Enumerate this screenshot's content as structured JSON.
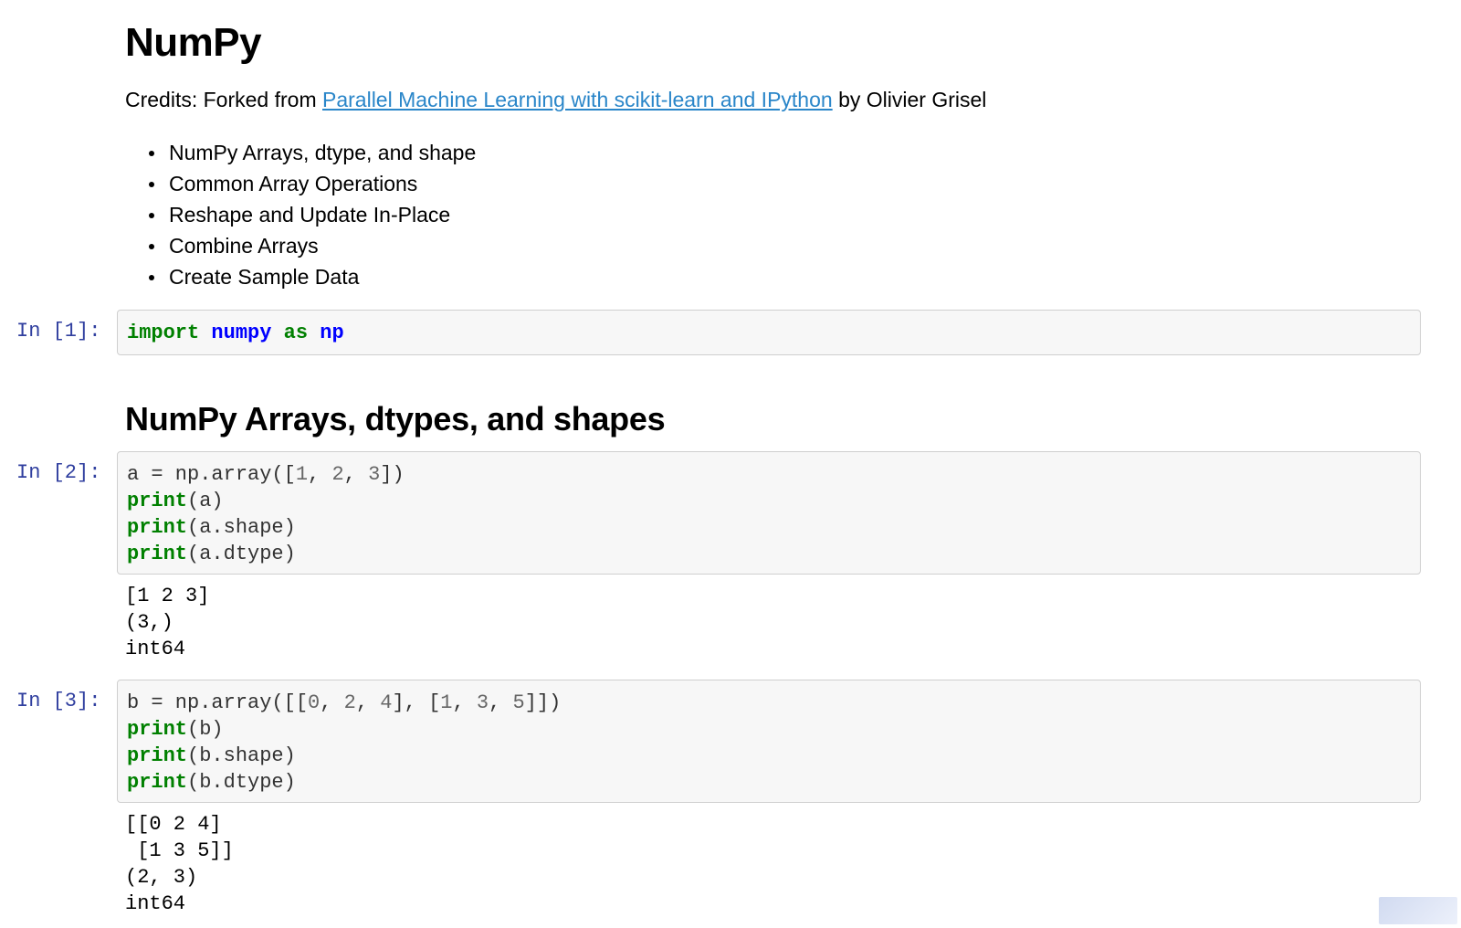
{
  "title": "NumPy",
  "credits": {
    "prefix": "Credits: Forked from ",
    "link_text": "Parallel Machine Learning with scikit-learn and IPython",
    "suffix": " by Olivier Grisel"
  },
  "toc": [
    "NumPy Arrays, dtype, and shape",
    "Common Array Operations",
    "Reshape and Update In-Place",
    "Combine Arrays",
    "Create Sample Data"
  ],
  "section_heading": "NumPy Arrays, dtypes, and shapes",
  "cells": [
    {
      "prompt": "In [1]:",
      "tokens": [
        [
          [
            "kw",
            "import"
          ],
          [
            "t",
            " "
          ],
          [
            "nm",
            "numpy"
          ],
          [
            "t",
            " "
          ],
          [
            "kw",
            "as"
          ],
          [
            "t",
            " "
          ],
          [
            "nm",
            "np"
          ]
        ]
      ],
      "output": ""
    },
    {
      "prompt": "In [2]:",
      "tokens": [
        [
          [
            "t",
            "a = np.array(["
          ],
          [
            "num",
            "1"
          ],
          [
            "t",
            ", "
          ],
          [
            "num",
            "2"
          ],
          [
            "t",
            ", "
          ],
          [
            "num",
            "3"
          ],
          [
            "t",
            "])"
          ]
        ],
        [
          [
            "kw",
            "print"
          ],
          [
            "t",
            "(a)"
          ]
        ],
        [
          [
            "kw",
            "print"
          ],
          [
            "t",
            "(a.shape)"
          ]
        ],
        [
          [
            "kw",
            "print"
          ],
          [
            "t",
            "(a.dtype)"
          ]
        ]
      ],
      "output": "[1 2 3]\n(3,)\nint64"
    },
    {
      "prompt": "In [3]:",
      "tokens": [
        [
          [
            "t",
            "b = np.array([["
          ],
          [
            "num",
            "0"
          ],
          [
            "t",
            ", "
          ],
          [
            "num",
            "2"
          ],
          [
            "t",
            ", "
          ],
          [
            "num",
            "4"
          ],
          [
            "t",
            "], ["
          ],
          [
            "num",
            "1"
          ],
          [
            "t",
            ", "
          ],
          [
            "num",
            "3"
          ],
          [
            "t",
            ", "
          ],
          [
            "num",
            "5"
          ],
          [
            "t",
            "]])"
          ]
        ],
        [
          [
            "kw",
            "print"
          ],
          [
            "t",
            "(b)"
          ]
        ],
        [
          [
            "kw",
            "print"
          ],
          [
            "t",
            "(b.shape)"
          ]
        ],
        [
          [
            "kw",
            "print"
          ],
          [
            "t",
            "(b.dtype)"
          ]
        ]
      ],
      "output": "[[0 2 4]\n [1 3 5]]\n(2, 3)\nint64"
    }
  ]
}
